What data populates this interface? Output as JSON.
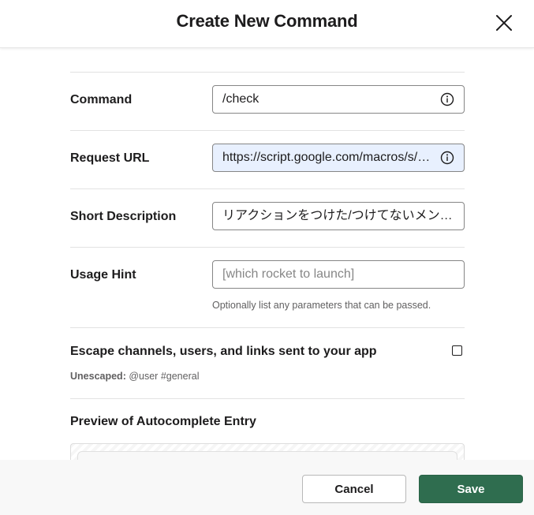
{
  "dialog": {
    "title": "Create New Command",
    "close_icon": "close-icon"
  },
  "form": {
    "command": {
      "label": "Command",
      "value": "/check",
      "icon": "info-icon"
    },
    "request_url": {
      "label": "Request URL",
      "value": "https://script.google.com/macros/s/…",
      "icon": "info-icon"
    },
    "short_description": {
      "label": "Short Description",
      "value": "リアクションをつけた/つけてないメン…"
    },
    "usage_hint": {
      "label": "Usage Hint",
      "placeholder": "[which rocket to launch]",
      "help": "Optionally list any parameters that can be passed."
    },
    "escape": {
      "label": "Escape channels, users, and links sent to your app",
      "checked": false,
      "note_prefix": "Unescaped:",
      "note_value": "@user #general"
    },
    "preview": {
      "label": "Preview of Autocomplete Entry"
    }
  },
  "footer": {
    "cancel_label": "Cancel",
    "save_label": "Save"
  },
  "colors": {
    "save_button": "#2f6d4f",
    "autofill_background": "#e8f0fe"
  }
}
